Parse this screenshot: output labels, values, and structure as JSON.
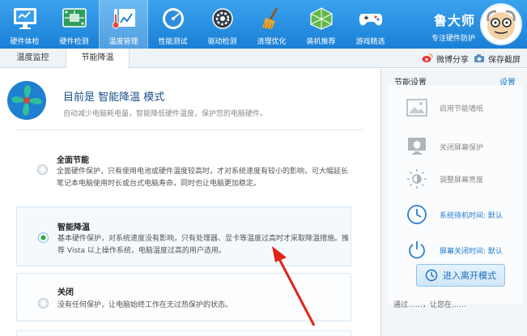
{
  "nav": [
    {
      "label": "硬件体检",
      "icon": "monitor-icon"
    },
    {
      "label": "硬件检测",
      "icon": "circuit-board-icon"
    },
    {
      "label": "温度管理",
      "icon": "thermometer-chart-icon"
    },
    {
      "label": "性能测试",
      "icon": "speedometer-icon"
    },
    {
      "label": "驱动检测",
      "icon": "gear-icon"
    },
    {
      "label": "清理优化",
      "icon": "broom-icon"
    },
    {
      "label": "装机推荐",
      "icon": "cube-icon"
    },
    {
      "label": "游戏精选",
      "icon": "gamepad-icon"
    }
  ],
  "brand": {
    "name": "鲁大师",
    "subtitle": "专注硬件防护"
  },
  "subtabs": [
    "温度监控",
    "节能降温"
  ],
  "actions": {
    "share": "微博分享",
    "screenshot": "保存截屏"
  },
  "mode": {
    "title": "目前是 智能降温 模式",
    "desc": "自动减少电脑耗电量，智能降低硬件温度，保护您的电脑硬件。"
  },
  "options": [
    {
      "title": "全面节能",
      "desc": "全面硬件保护，只有使用电池或硬件温度较高时，才对系统速度有较小的影响，可大幅延长笔记本电脑使用时长或台式电脑寿命，同时也让电脑更加稳定。"
    },
    {
      "title": "智能降温",
      "desc": "基本硬件保护，对系统速度没有影响，只有处理器、显卡等温度过高时才采取降温措施。推荐 Vista 以上操作系统，电脑温度过高的用户选用。"
    },
    {
      "title": "关闭",
      "desc": "没有任何保护，让电脑始终工作在无过热保护的状态。"
    }
  ],
  "panel": {
    "title": "节能设置",
    "link": "设置",
    "items": [
      {
        "label": "启用节能墙纸",
        "icon": "wallpaper-icon"
      },
      {
        "label": "关闭屏幕保护",
        "icon": "screensaver-icon"
      },
      {
        "label": "调整屏幕亮度",
        "icon": "brightness-icon"
      },
      {
        "label": "系统待机时间: 默认",
        "icon": "clock-icon"
      },
      {
        "label": "屏幕关闭时间: 默认",
        "icon": "power-icon"
      }
    ],
    "button": "进入离开模式",
    "note": "通过……，让您在……"
  }
}
